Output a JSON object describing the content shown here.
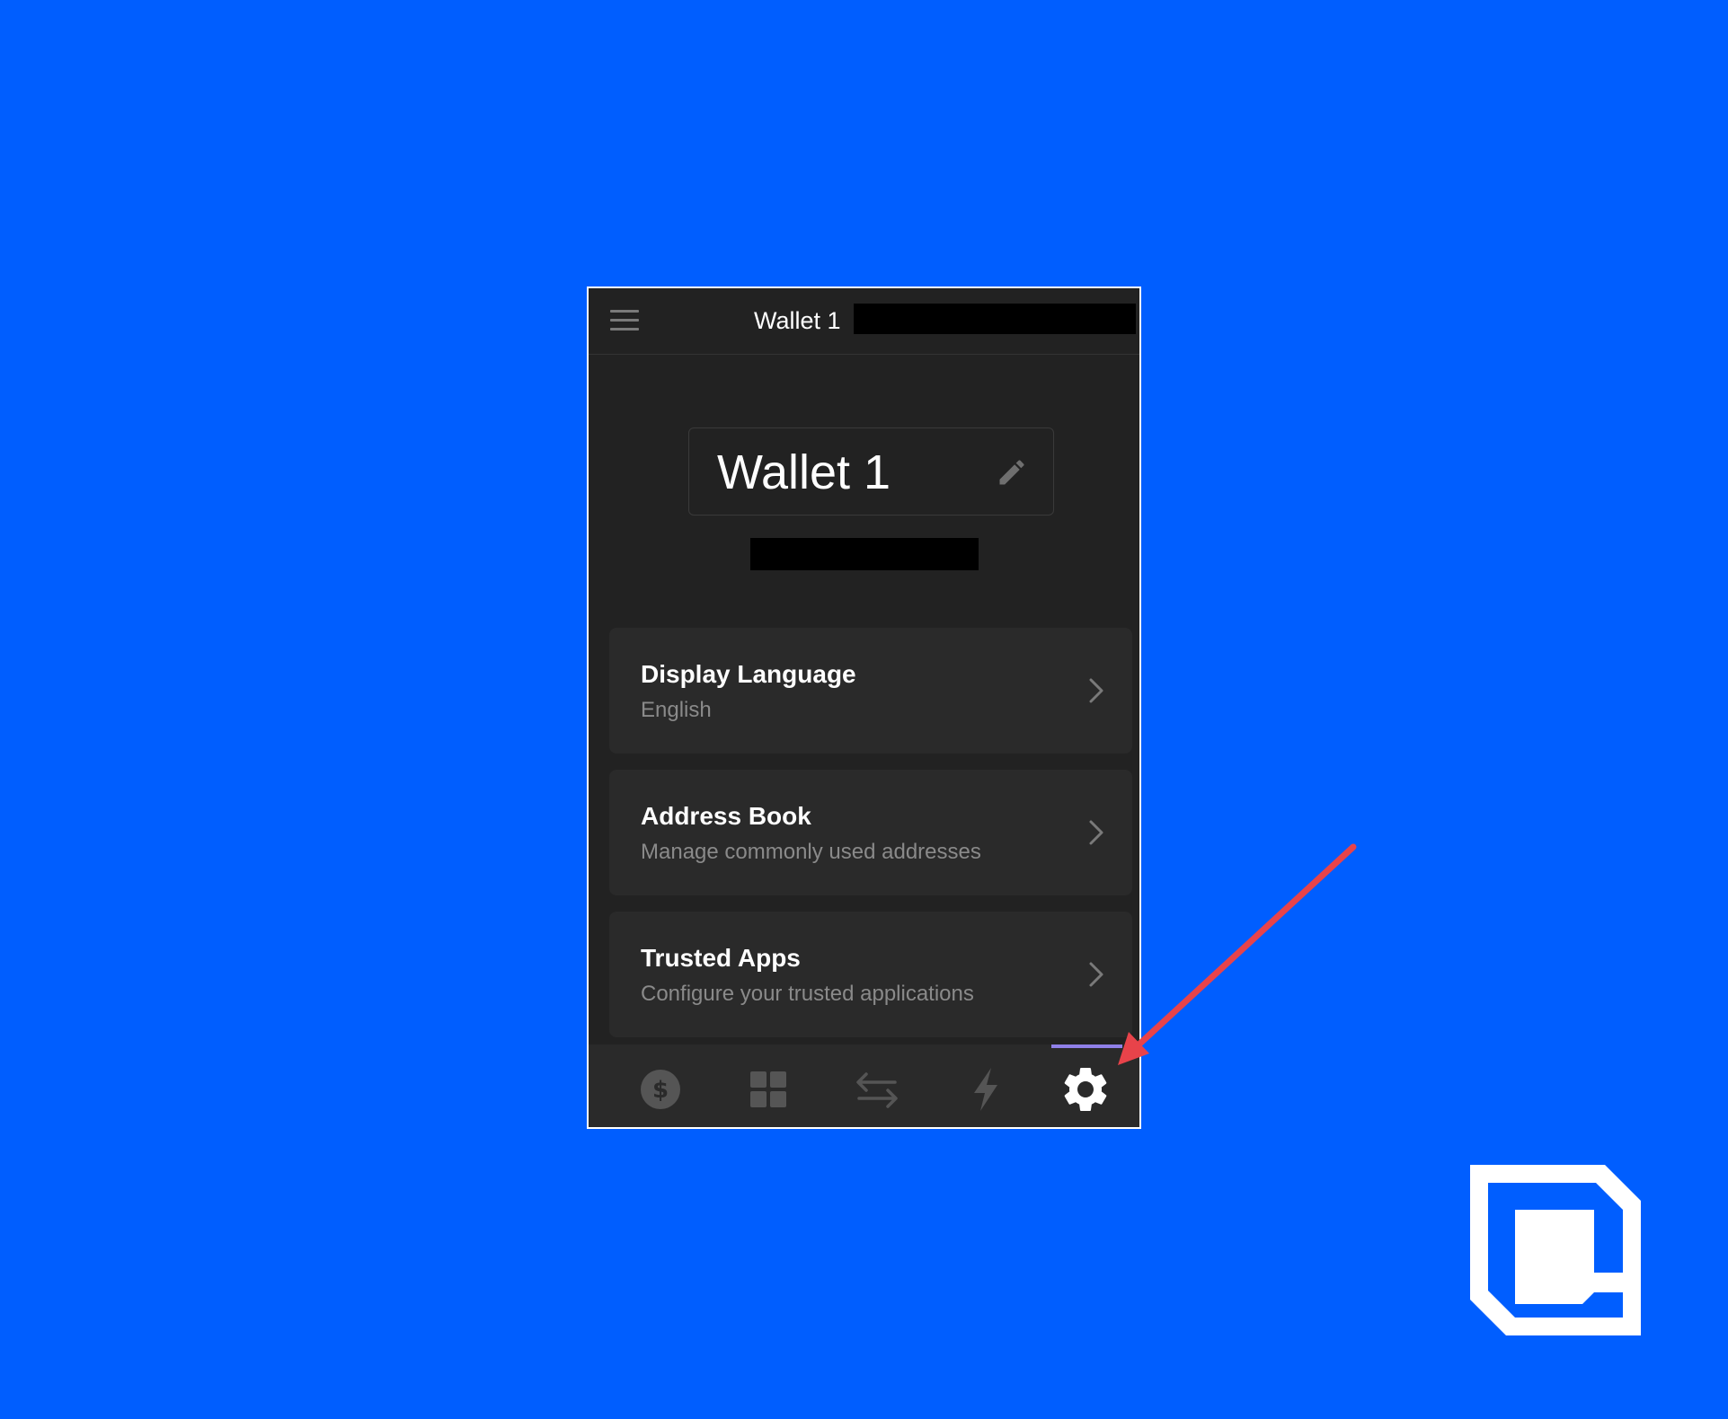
{
  "header": {
    "title": "Wallet 1"
  },
  "wallet": {
    "name": "Wallet 1"
  },
  "settings": {
    "items": [
      {
        "title": "Display Language",
        "subtitle": "English"
      },
      {
        "title": "Address Book",
        "subtitle": "Manage commonly used addresses"
      },
      {
        "title": "Trusted Apps",
        "subtitle": "Configure your trusted applications"
      }
    ]
  },
  "nav": {
    "items": [
      {
        "icon": "dollar-coin-icon",
        "active": false
      },
      {
        "icon": "grid-icon",
        "active": false
      },
      {
        "icon": "swap-arrows-icon",
        "active": false
      },
      {
        "icon": "lightning-icon",
        "active": false
      },
      {
        "icon": "gear-icon",
        "active": true
      }
    ]
  },
  "colors": {
    "background": "#005eff",
    "panel": "#222222",
    "card": "#2a2a2a",
    "active_indicator": "#8f80e8",
    "annotation_arrow": "#e8434a",
    "inactive_icon": "#555555"
  }
}
